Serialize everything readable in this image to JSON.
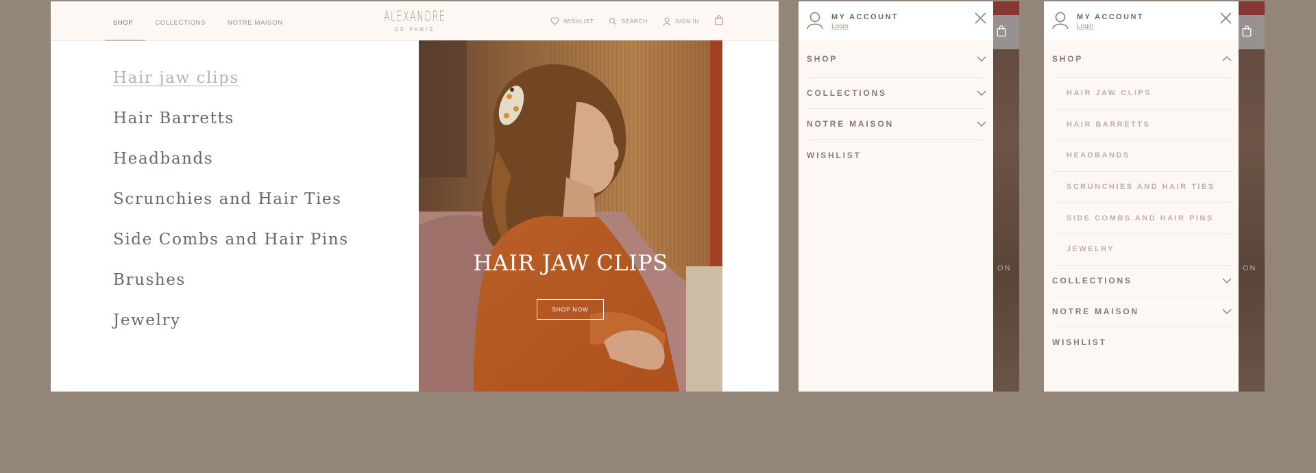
{
  "desktop": {
    "nav": [
      {
        "label": "SHOP",
        "active": true
      },
      {
        "label": "COLLECTIONS",
        "active": false
      },
      {
        "label": "NOTRE MAISON",
        "active": false
      }
    ],
    "logo": {
      "main": "ALEXANDRE",
      "sub": "DE PARIS"
    },
    "utilities": {
      "wishlist": "WISHLIST",
      "search": "SEARCH",
      "signin": "SIGN IN"
    },
    "menu": [
      {
        "label": "Hair jaw clips",
        "active": true
      },
      {
        "label": "Hair Barretts",
        "active": false
      },
      {
        "label": "Headbands",
        "active": false
      },
      {
        "label": "Scrunchies and Hair Ties",
        "active": false
      },
      {
        "label": "Side Combs and Hair Pins",
        "active": false
      },
      {
        "label": "Brushes",
        "active": false
      },
      {
        "label": "Jewelry",
        "active": false
      }
    ],
    "hero": {
      "title": "HAIR JAW CLIPS",
      "button": "SHOP NOW"
    }
  },
  "mobile_collapsed": {
    "account": {
      "title": "MY ACCOUNT",
      "login": "Login"
    },
    "rows": [
      {
        "label": "SHOP",
        "chevron": "chevron-down"
      },
      {
        "label": "COLLECTIONS",
        "chevron": "chevron-down"
      },
      {
        "label": "NOTRE MAISON",
        "chevron": "chevron-down"
      },
      {
        "label": "WISHLIST",
        "chevron": ""
      }
    ],
    "background_text": "ON"
  },
  "mobile_expanded": {
    "account": {
      "title": "MY ACCOUNT",
      "login": "Login"
    },
    "shop": {
      "label": "SHOP",
      "chevron": "chevron-up"
    },
    "submenu": [
      "HAIR JAW CLIPS",
      "HAIR BARRETTS",
      "HEADBANDS",
      "SCRUNCHIES AND HAIR TIES",
      "SIDE COMBS AND HAIR PINS",
      "JEWELRY"
    ],
    "rows": [
      {
        "label": "COLLECTIONS",
        "chevron": "chevron-down"
      },
      {
        "label": "NOTRE MAISON",
        "chevron": "chevron-down"
      },
      {
        "label": "WISHLIST",
        "chevron": ""
      }
    ],
    "background_text": "ON"
  },
  "colors": {
    "page_bg": "#938577",
    "drawer_bg": "#fdf8f4",
    "text": "#6e6760",
    "muted": "#bbb1a8",
    "accent_red": "#873732"
  }
}
